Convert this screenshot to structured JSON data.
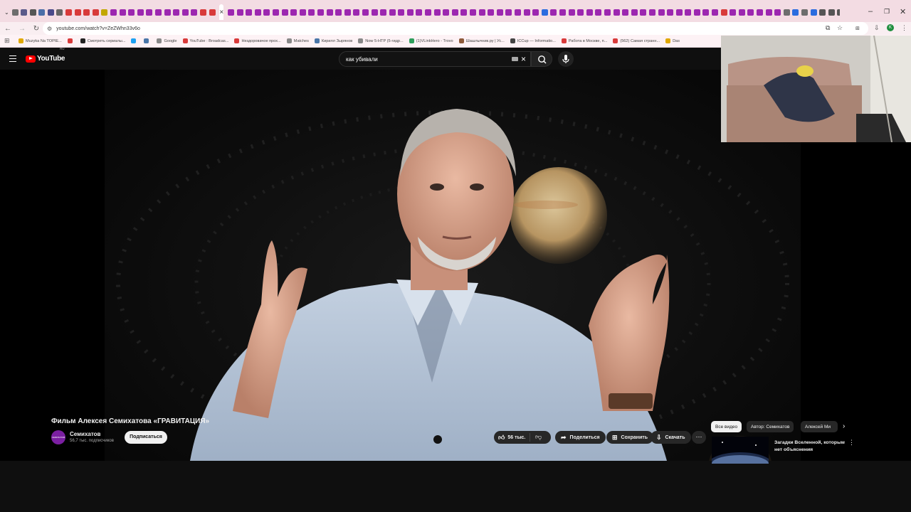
{
  "browser": {
    "tab_colors": [
      "#6d6d6d",
      "#5a5a8a",
      "#555",
      "#4a6ea8",
      "#4a4a8a",
      "#666",
      "#d83a3a",
      "#d83a3a",
      "#d83a3a",
      "#d83a3a",
      "#c2a700",
      "#9c27b0",
      "#9c27b0",
      "#9c27b0",
      "#9c27b0",
      "#9c27b0",
      "#9c27b0",
      "#9c27b0",
      "#9c27b0",
      "#9c27b0",
      "#9c27b0",
      "#d83a3a",
      "#d83a3a"
    ],
    "tab_colors_right": [
      "#9c27b0",
      "#9c27b0",
      "#9c27b0",
      "#9c27b0",
      "#9c27b0",
      "#9c27b0",
      "#9c27b0",
      "#9c27b0",
      "#9c27b0",
      "#9c27b0",
      "#9c27b0",
      "#9c27b0",
      "#9c27b0",
      "#9c27b0",
      "#9c27b0",
      "#9c27b0",
      "#9c27b0",
      "#9c27b0",
      "#9c27b0",
      "#9c27b0",
      "#9c27b0",
      "#9c27b0",
      "#9c27b0",
      "#9c27b0",
      "#9c27b0",
      "#9c27b0",
      "#9c27b0",
      "#9c27b0",
      "#9c27b0",
      "#9c27b0",
      "#9c27b0",
      "#9c27b0",
      "#9c27b0",
      "#9c27b0",
      "#9c27b0",
      "#2b6cdf",
      "#9c27b0",
      "#9c27b0",
      "#9c27b0",
      "#9c27b0",
      "#9c27b0",
      "#9c27b0",
      "#9c27b0",
      "#9c27b0",
      "#9c27b0",
      "#9c27b0",
      "#9c27b0",
      "#9c27b0",
      "#9c27b0",
      "#9c27b0",
      "#9c27b0",
      "#9c27b0",
      "#9c27b0",
      "#9c27b0",
      "#9c27b0",
      "#d83a3a",
      "#9c27b0",
      "#9c27b0",
      "#9c27b0",
      "#9c27b0",
      "#9c27b0",
      "#9c27b0",
      "#6d6d6d",
      "#2b6cdf",
      "#6d6d6d",
      "#2b6cdf",
      "#555",
      "#555",
      "#555",
      "#2e7d32",
      "#555",
      "#2b6cdf",
      "#d83a3a",
      "#e0a800",
      "#2b6cdf"
    ],
    "active_tab_close": "×",
    "new_tab": "+",
    "url": "youtube.com/watch?v=ZeZWhn33v6o",
    "bookmarks": [
      {
        "label": "Muzyka Na TOPIE...",
        "color": "#e0a800"
      },
      {
        "label": "",
        "color": "#d83a3a"
      },
      {
        "label": "Смотреть сериалы...",
        "color": "#222"
      },
      {
        "label": "",
        "color": "#1da1f2"
      },
      {
        "label": "",
        "color": "#4a76a8"
      },
      {
        "label": "Google",
        "color": "#888"
      },
      {
        "label": "YouTube : Broadcas...",
        "color": "#d83a3a"
      },
      {
        "label": "Нездоровачое прох...",
        "color": "#d83a3a"
      },
      {
        "label": "Matches",
        "color": "#888"
      },
      {
        "label": "Кирилл Зырянов",
        "color": "#4a76a8"
      },
      {
        "label": "Now 5-HTP (5-гидр...",
        "color": "#888"
      },
      {
        "label": "(1)VLinkHero - Trovo",
        "color": "#2e9e5b"
      },
      {
        "label": "Шашлычник.ру | Ус...",
        "color": "#8d5a3a"
      },
      {
        "label": "ICCup — Informatio...",
        "color": "#444"
      },
      {
        "label": "Работа в Москве, п...",
        "color": "#d83a3a"
      },
      {
        "label": "(562) Самая странн...",
        "color": "#d83a3a"
      },
      {
        "label": "Das",
        "color": "#e0a800"
      }
    ]
  },
  "youtube": {
    "logo_text": "YouTube",
    "country": "RU",
    "search_query": "как убивали",
    "video": {
      "title": "Фильм Алексея Семихатова «ГРАВИТАЦИЯ»",
      "channel": "Семихатов",
      "channel_avatar_text": "СЕМИХАТОВ",
      "subscribers": "56,7 тыс. подписчиков",
      "subscribe_label": "Подписаться",
      "likes": "56 тыс.",
      "share_label": "Поделиться",
      "save_label": "Сохранить",
      "download_label": "Скачать"
    },
    "chips": [
      "Все видео",
      "Автор: Семихатов",
      "Алексей Ми"
    ],
    "recommendation": {
      "title": "Загадки Вселенной, которым нет объяснения"
    }
  }
}
